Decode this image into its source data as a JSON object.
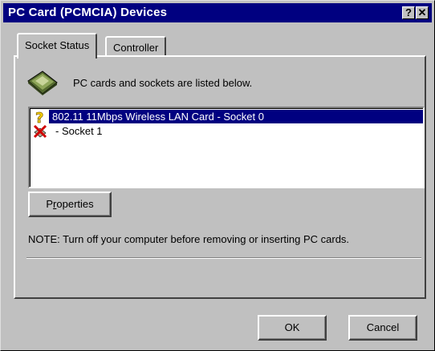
{
  "window": {
    "title": "PC Card (PCMCIA) Devices",
    "help_button": "?",
    "close_button": "✕"
  },
  "tabs": [
    {
      "label": "Socket Status",
      "active": true
    },
    {
      "label": "Controller",
      "active": false
    }
  ],
  "socket_status": {
    "icon": "pc-card-icon",
    "description": "PC cards and sockets are listed below.",
    "devices": [
      {
        "icon": "question-mark-icon",
        "label": "802.11 11Mbps Wireless LAN Card - Socket 0",
        "selected": true
      },
      {
        "icon": "empty-socket-x-icon",
        "label": "- Socket 1",
        "selected": false
      }
    ],
    "properties_button": {
      "prefix": "P",
      "underline": "r",
      "suffix": "operties"
    },
    "note": "NOTE: Turn off your computer before removing or inserting  PC cards."
  },
  "footer": {
    "ok_label": "OK",
    "cancel_label": "Cancel"
  },
  "colors": {
    "titlebar": "#000080",
    "face": "#c0c0c0",
    "selection": "#000080"
  }
}
